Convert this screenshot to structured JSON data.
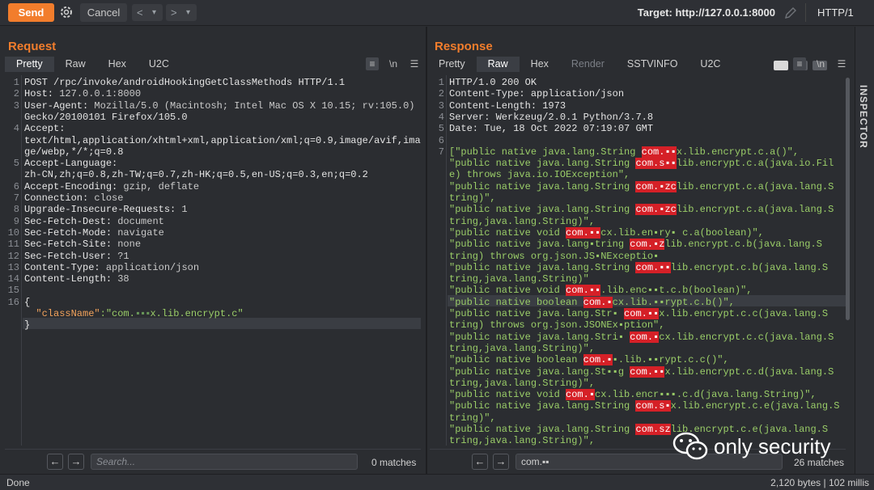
{
  "toolbar": {
    "send_label": "Send",
    "cancel_label": "Cancel",
    "back_label": "<",
    "back_menu": "▾",
    "forward_label": ">",
    "forward_menu": "▾",
    "target": "Target: http://127.0.0.1:8000",
    "http_version": "HTTP/1"
  },
  "request": {
    "title": "Request",
    "tabs": [
      "Pretty",
      "Raw",
      "Hex",
      "U2C"
    ],
    "active_tab": "Pretty",
    "lines": [
      {
        "n": "1",
        "t": "POST /rpc/invoke/androidHookingGetClassMethods HTTP/1.1"
      },
      {
        "n": "2",
        "k": "Host:",
        "v": " 127.0.0.1:8000"
      },
      {
        "n": "3",
        "k": "User-Agent:",
        "v": " Mozilla/5.0 (Macintosh; Intel Mac OS X 10.15; rv:105.0)"
      },
      {
        "n": "",
        "t": "Gecko/20100101 Firefox/105.0"
      },
      {
        "n": "4",
        "k": "Accept:",
        "v": ""
      },
      {
        "n": "",
        "t": "text/html,application/xhtml+xml,application/xml;q=0.9,image/avif,ima"
      },
      {
        "n": "",
        "t": "ge/webp,*/*;q=0.8"
      },
      {
        "n": "5",
        "k": "Accept-Language:",
        "v": ""
      },
      {
        "n": "",
        "t": "zh-CN,zh;q=0.8,zh-TW;q=0.7,zh-HK;q=0.5,en-US;q=0.3,en;q=0.2"
      },
      {
        "n": "6",
        "k": "Accept-Encoding:",
        "v": " gzip, deflate"
      },
      {
        "n": "7",
        "k": "Connection:",
        "v": " close"
      },
      {
        "n": "8",
        "k": "Upgrade-Insecure-Requests:",
        "v": " 1"
      },
      {
        "n": "9",
        "k": "Sec-Fetch-Dest:",
        "v": " document"
      },
      {
        "n": "10",
        "k": "Sec-Fetch-Mode:",
        "v": " navigate"
      },
      {
        "n": "11",
        "k": "Sec-Fetch-Site:",
        "v": " none"
      },
      {
        "n": "12",
        "k": "Sec-Fetch-User:",
        "v": " ?1"
      },
      {
        "n": "13",
        "k": "Content-Type:",
        "v": " application/json"
      },
      {
        "n": "14",
        "k": "Content-Length:",
        "v": " 38"
      },
      {
        "n": "15",
        "t": ""
      },
      {
        "n": "16",
        "t": "{"
      },
      {
        "n": "",
        "jk": "  \"className\"",
        "jv": ":\"com.",
        "blur": "▪▪▪",
        "jv2": "x.lib.encrypt.c\""
      },
      {
        "n": "",
        "t": "}"
      }
    ],
    "search_placeholder": "Search...",
    "matches": "0 matches"
  },
  "response": {
    "title": "Response",
    "tabs": [
      "Pretty",
      "Raw",
      "Hex",
      "Render",
      "SSTVINFO",
      "U2C"
    ],
    "active_tab": "Raw",
    "lines": [
      {
        "n": "1",
        "t": "HTTP/1.0 200 OK"
      },
      {
        "n": "2",
        "t": "Content-Type: application/json"
      },
      {
        "n": "3",
        "t": "Content-Length: 1973"
      },
      {
        "n": "4",
        "t": "Server: Werkzeug/2.0.1 Python/3.7.8"
      },
      {
        "n": "5",
        "t": "Date: Tue, 18 Oct 2022 07:19:07 GMT"
      },
      {
        "n": "6",
        "t": ""
      },
      {
        "n": "7",
        "p": "[\"public native java.lang.String ",
        "r": "com.▪▪",
        "s": "x.lib.encrypt.c.a()\","
      },
      {
        "n": "",
        "p": "\"public native java.lang.String ",
        "r": "com.s▪▪",
        "s": "lib.encrypt.c.a(java.io.Fil"
      },
      {
        "n": "",
        "p": "e) throws java.io.IOException\","
      },
      {
        "n": "",
        "p": "\"public native java.lang.String ",
        "r": "com.▪zc",
        "s": "lib.encrypt.c.a(java.lang.S"
      },
      {
        "n": "",
        "p": "tring)\","
      },
      {
        "n": "",
        "p": "\"public native java.lang.String ",
        "r": "com.▪zc",
        "s": "lib.encrypt.c.a(java.lang.S"
      },
      {
        "n": "",
        "p": "tring,java.lang.String)\","
      },
      {
        "n": "",
        "p": "\"public native void ",
        "r": "com.▪▪",
        "s": "cx.lib.en▪ry▪ c.a(boolean)\","
      },
      {
        "n": "",
        "p": "\"public native java.lang▪tring ",
        "r": "com.▪z",
        "s": "lib.encrypt.c.b(java.lang.S"
      },
      {
        "n": "",
        "p": "tring) throws org.json.JS▪NExceptio▪"
      },
      {
        "n": "",
        "p": "\"public native java.lang.String ",
        "r": "com.▪▪",
        "s": "lib.encrypt.c.b(java.lang.S"
      },
      {
        "n": "",
        "p": "tring,java.lang.String)\""
      },
      {
        "n": "",
        "p": "\"public native void ",
        "r": "com.▪▪",
        "s": ".lib.enc▪▪t.c.b(boolean)\","
      },
      {
        "n": "",
        "p": "\"public native boolean ",
        "r": "com.▪",
        "s": "cx.lib.▪▪rypt.c.b()\","
      },
      {
        "n": "",
        "p": "\"public native java.lang.Str▪ ",
        "r": "com.▪▪",
        "s": "x.lib.encrypt.c.c(java.lang.S"
      },
      {
        "n": "",
        "p": "tring) throws org.json.JSONEx▪ption\","
      },
      {
        "n": "",
        "p": "\"public native java.lang.Stri▪ ",
        "r": "com.▪",
        "s": "cx.lib.encrypt.c.c(java.lang.S"
      },
      {
        "n": "",
        "p": "tring,java.lang.String)\","
      },
      {
        "n": "",
        "p": "\"public native boolean ",
        "r": "com.▪",
        "s": "▪.lib.▪▪rypt.c.c()\","
      },
      {
        "n": "",
        "p": "\"public native java.lang.St▪▪g ",
        "r": "com.▪▪",
        "s": "x.lib.encrypt.c.d(java.lang.S"
      },
      {
        "n": "",
        "p": "tring,java.lang.String)\","
      },
      {
        "n": "",
        "p": "\"public native void ",
        "r": "com.▪",
        "s": "cx.lib.encr▪▪▪.c.d(java.lang.String)\","
      },
      {
        "n": "",
        "p": "\"public native java.lang.String ",
        "r": "com.s▪",
        "s": "x.lib.encrypt.c.e(java.lang.S"
      },
      {
        "n": "",
        "p": "tring)\","
      },
      {
        "n": "",
        "p": "\"public native java.lang.String ",
        "r": "com.sz",
        "s": "lib.encrypt.c.e(java.lang.S"
      },
      {
        "n": "",
        "p": "tring,java.lang.String)\","
      }
    ],
    "search_value": "com.▪▪",
    "matches": "26 matches"
  },
  "inspector": {
    "label": "INSPECTOR"
  },
  "status": {
    "left": "Done",
    "right": "2,120 bytes | 102 millis"
  },
  "watermark": {
    "text": "only security"
  },
  "colors": {
    "accent": "#f27d2c",
    "redact": "#d52027",
    "string": "#9acd68"
  }
}
